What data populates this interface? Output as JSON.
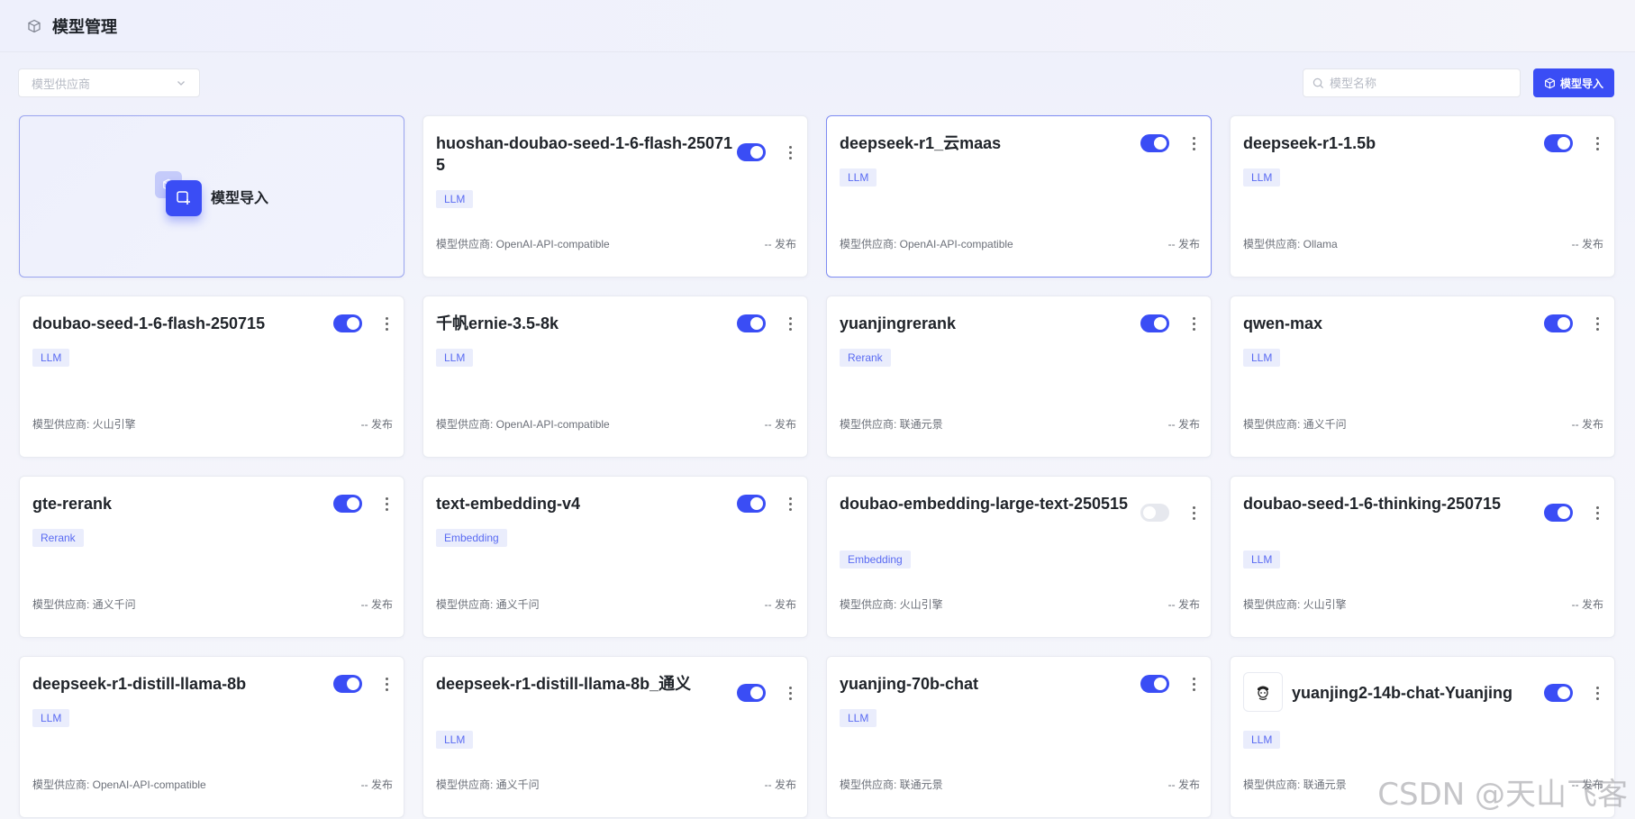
{
  "header": {
    "title": "模型管理"
  },
  "toolbar": {
    "provider_placeholder": "模型供应商",
    "search_placeholder": "模型名称",
    "import_label": "模型导入"
  },
  "import_card": {
    "label": "模型导入"
  },
  "labels": {
    "provider_prefix": "模型供应商: ",
    "publish": "-- 发布"
  },
  "models": [
    {
      "name": "huoshan-doubao-seed-1-6-flash-250715",
      "type": "LLM",
      "provider": "OpenAI-API-compatible",
      "enabled": true
    },
    {
      "name": "deepseek-r1_云maas",
      "type": "LLM",
      "provider": "OpenAI-API-compatible",
      "enabled": true
    },
    {
      "name": "deepseek-r1-1.5b",
      "type": "LLM",
      "provider": "Ollama",
      "enabled": true
    },
    {
      "name": "doubao-seed-1-6-flash-250715",
      "type": "LLM",
      "provider": "火山引擎",
      "enabled": true
    },
    {
      "name": "千帆ernie-3.5-8k",
      "type": "LLM",
      "provider": "OpenAI-API-compatible",
      "enabled": true
    },
    {
      "name": "yuanjingrerank",
      "type": "Rerank",
      "provider": "联通元景",
      "enabled": true
    },
    {
      "name": "qwen-max",
      "type": "LLM",
      "provider": "通义千问",
      "enabled": true
    },
    {
      "name": "gte-rerank",
      "type": "Rerank",
      "provider": "通义千问",
      "enabled": true
    },
    {
      "name": "text-embedding-v4",
      "type": "Embedding",
      "provider": "通义千问",
      "enabled": true
    },
    {
      "name": "doubao-embedding-large-text-250515",
      "type": "Embedding",
      "provider": "火山引擎",
      "enabled": false
    },
    {
      "name": "doubao-seed-1-6-thinking-250715",
      "type": "LLM",
      "provider": "火山引擎",
      "enabled": true
    },
    {
      "name": "deepseek-r1-distill-llama-8b",
      "type": "LLM",
      "provider": "OpenAI-API-compatible",
      "enabled": true
    },
    {
      "name": "deepseek-r1-distill-llama-8b_通义",
      "type": "LLM",
      "provider": "通义千问",
      "enabled": true
    },
    {
      "name": "yuanjing-70b-chat",
      "type": "LLM",
      "provider": "联通元景",
      "enabled": true
    },
    {
      "name": "yuanjing2-14b-chat-Yuanjing",
      "type": "LLM",
      "provider": "联通元景",
      "enabled": true
    }
  ],
  "watermark": "CSDN @天山飞客"
}
